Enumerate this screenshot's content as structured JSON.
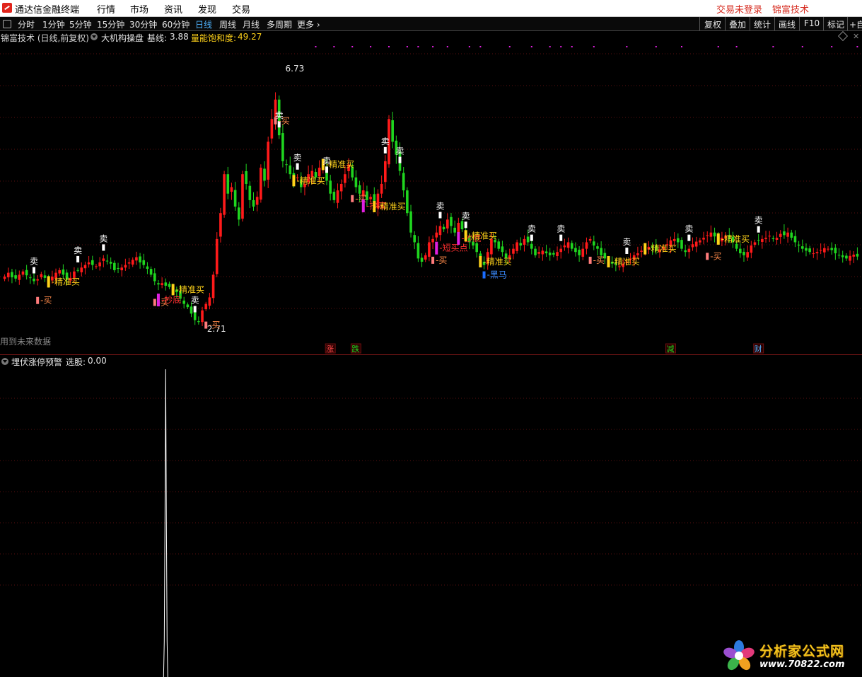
{
  "menubar": {
    "app_title": "通达信金融终端",
    "items": [
      "行情",
      "市场",
      "资讯",
      "发现",
      "交易"
    ],
    "right": [
      "交易未登录",
      "锦富技术"
    ]
  },
  "toolbar": {
    "periods": [
      "分时",
      "1分钟",
      "5分钟",
      "15分钟",
      "30分钟",
      "60分钟",
      "日线",
      "周线",
      "月线",
      "多周期",
      "更多 ›"
    ],
    "active_period": "日线",
    "right_buttons": [
      "复权",
      "叠加",
      "统计",
      "画线",
      "F10",
      "标记",
      "+自"
    ]
  },
  "infobar": {
    "stock": "锦富技术 (日线,前复权)",
    "indicator": "大机构操盘",
    "baseline_label": "基线:",
    "baseline_value": "3.88",
    "energy_label": "量能饱和度:",
    "energy_value": "49.27"
  },
  "main_chart_note": "用到未来数据",
  "sub_indicator": {
    "name": "埋伏涨停预警",
    "select_label": "选股:",
    "select_value": "0.00"
  },
  "colors": {
    "up": "#ff1a1a",
    "down": "#1fd51f",
    "grid": "#5a1010",
    "buy_yellow": "#ffd21a",
    "buy_pink": "#ff7b7b",
    "bottom_magenta": "#e020e0",
    "darkhorse_blue": "#1a6cff",
    "sell_white": "#ffffff",
    "menu_red": "#d62b1f",
    "active_tab": "#4fb4ff",
    "energy_yellow": "#ffd21a"
  },
  "chart_data": {
    "type": "candlestick",
    "price_high_label": "6.73",
    "price_low_label": "2.71",
    "n_bars": 240,
    "close": [
      3.52,
      3.58,
      3.51,
      3.49,
      3.55,
      3.6,
      3.54,
      3.5,
      3.45,
      3.48,
      3.56,
      3.5,
      3.44,
      3.52,
      3.58,
      3.62,
      3.55,
      3.48,
      3.5,
      3.6,
      3.62,
      3.66,
      3.7,
      3.74,
      3.7,
      3.68,
      3.74,
      3.8,
      3.76,
      3.72,
      3.62,
      3.64,
      3.66,
      3.7,
      3.74,
      3.78,
      3.82,
      3.74,
      3.7,
      3.64,
      3.55,
      3.45,
      3.4,
      3.42,
      3.38,
      3.36,
      3.32,
      3.28,
      3.18,
      3.1,
      3.05,
      2.95,
      2.85,
      2.82,
      3.0,
      3.1,
      3.2,
      3.55,
      4.1,
      4.5,
      5.1,
      4.8,
      4.9,
      4.6,
      4.4,
      5.1,
      4.95,
      4.7,
      4.6,
      4.75,
      5.2,
      5.0,
      5.6,
      5.95,
      6.25,
      5.7,
      5.3,
      5.25,
      5.1,
      5.0,
      5.05,
      4.9,
      4.95,
      5.1,
      5.15,
      5.05,
      5.2,
      5.25,
      5.0,
      4.8,
      4.7,
      4.85,
      4.95,
      5.1,
      5.25,
      5.05,
      4.9,
      4.8,
      4.85,
      4.7,
      4.75,
      4.6,
      4.8,
      4.95,
      5.3,
      5.95,
      5.6,
      5.4,
      5.15,
      4.85,
      4.5,
      4.2,
      4.05,
      3.8,
      3.75,
      3.85,
      4.05,
      4.1,
      4.2,
      4.3,
      4.25,
      4.4,
      4.3,
      4.2,
      4.35,
      4.25,
      4.15,
      4.05,
      4.0,
      3.9,
      3.75,
      3.7,
      3.9,
      4.1,
      4.05,
      3.95,
      3.9,
      3.8,
      3.85,
      3.95,
      4.05,
      4.0,
      4.1,
      4.05,
      3.95,
      3.85,
      3.9,
      3.92,
      3.88,
      3.85,
      3.86,
      3.9,
      3.95,
      4.0,
      4.05,
      3.95,
      3.9,
      3.85,
      3.95,
      4.05,
      4.1,
      4.0,
      3.95,
      3.85,
      3.8,
      3.75,
      3.72,
      3.7,
      3.68,
      3.72,
      3.75,
      3.8,
      3.85,
      3.88,
      3.92,
      3.95,
      3.98,
      3.96,
      3.92,
      3.94,
      3.98,
      4.02,
      4.08,
      4.1,
      4.05,
      3.95,
      3.9,
      3.95,
      4.02,
      4.06,
      4.08,
      4.12,
      4.16,
      4.2,
      4.14,
      4.1,
      4.12,
      4.15,
      4.1,
      4.05,
      3.95,
      3.88,
      3.85,
      3.9,
      4.0,
      4.05,
      4.08,
      4.1,
      4.12,
      4.15,
      4.1,
      4.12,
      4.18,
      4.16,
      4.2,
      4.12,
      4.05,
      4.0,
      3.95,
      3.92,
      3.9,
      3.88,
      3.9,
      3.93,
      3.96,
      3.95,
      3.93,
      3.88,
      3.85,
      3.82,
      3.8,
      3.84,
      3.86,
      3.83
    ],
    "signals": [
      {
        "bar": 9,
        "text": "买",
        "kind": "buy"
      },
      {
        "bar": 12,
        "text": "精准买",
        "kind": "precise"
      },
      {
        "bar": 8,
        "text": "卖",
        "kind": "sell"
      },
      {
        "bar": 20,
        "text": "卖",
        "kind": "sell"
      },
      {
        "bar": 27,
        "text": "卖",
        "kind": "sell"
      },
      {
        "bar": 41,
        "text": "买",
        "kind": "buy"
      },
      {
        "bar": 42,
        "text": "抄底",
        "kind": "bottom"
      },
      {
        "bar": 46,
        "text": "精准买",
        "kind": "precise"
      },
      {
        "bar": 52,
        "text": "卖",
        "kind": "sell"
      },
      {
        "bar": 55,
        "text": "买",
        "kind": "buy"
      },
      {
        "bar": 75,
        "text": "卖",
        "kind": "sell"
      },
      {
        "bar": 74,
        "text": "买",
        "kind": "buy"
      },
      {
        "bar": 79,
        "text": "精准买",
        "kind": "precise"
      },
      {
        "bar": 80,
        "text": "卖",
        "kind": "sell"
      },
      {
        "bar": 87,
        "text": "精准买",
        "kind": "precise"
      },
      {
        "bar": 88,
        "text": "卖",
        "kind": "sell"
      },
      {
        "bar": 95,
        "text": "买",
        "kind": "buy"
      },
      {
        "bar": 98,
        "text": "抄底",
        "kind": "bottom"
      },
      {
        "bar": 101,
        "text": "精准买",
        "kind": "precise"
      },
      {
        "bar": 104,
        "text": "卖",
        "kind": "sell"
      },
      {
        "bar": 108,
        "text": "卖",
        "kind": "sell"
      },
      {
        "bar": 117,
        "text": "买",
        "kind": "buy"
      },
      {
        "bar": 118,
        "text": "短买点",
        "kind": "bottom"
      },
      {
        "bar": 119,
        "text": "卖",
        "kind": "sell"
      },
      {
        "bar": 124,
        "text": "抄底",
        "kind": "bottom"
      },
      {
        "bar": 126,
        "text": "精准买",
        "kind": "precise"
      },
      {
        "bar": 126,
        "text": "卖",
        "kind": "sell"
      },
      {
        "bar": 130,
        "text": "精准买",
        "kind": "precise"
      },
      {
        "bar": 131,
        "text": "黑马",
        "kind": "darkhorse"
      },
      {
        "bar": 144,
        "text": "卖",
        "kind": "sell"
      },
      {
        "bar": 152,
        "text": "卖",
        "kind": "sell"
      },
      {
        "bar": 160,
        "text": "买",
        "kind": "buy"
      },
      {
        "bar": 165,
        "text": "精准买",
        "kind": "precise"
      },
      {
        "bar": 170,
        "text": "卖",
        "kind": "sell"
      },
      {
        "bar": 175,
        "text": "精准买",
        "kind": "precise"
      },
      {
        "bar": 187,
        "text": "卖",
        "kind": "sell"
      },
      {
        "bar": 192,
        "text": "买",
        "kind": "buy"
      },
      {
        "bar": 195,
        "text": "精准买",
        "kind": "precise"
      },
      {
        "bar": 206,
        "text": "卖",
        "kind": "sell"
      }
    ],
    "top_dots_bars": [
      85,
      90,
      95,
      100,
      105,
      110,
      113,
      117,
      121,
      127,
      130,
      138,
      144,
      149,
      152,
      155,
      161,
      170,
      178,
      185,
      195,
      200,
      210,
      218,
      226,
      233,
      238
    ],
    "news_tags": [
      {
        "bar": 89,
        "text": "涨",
        "color": "#ff4a4a"
      },
      {
        "bar": 96,
        "text": "跌",
        "color": "#1fd51f"
      },
      {
        "bar": 182,
        "text": "减",
        "color": "#1fd51f"
      },
      {
        "bar": 206,
        "text": "财",
        "color": "#4fb4ff"
      }
    ],
    "sub_spike": {
      "bar": 44,
      "value": 1.0
    }
  },
  "watermark": {
    "title": "分析家公式网",
    "url": "www.70822.com"
  }
}
